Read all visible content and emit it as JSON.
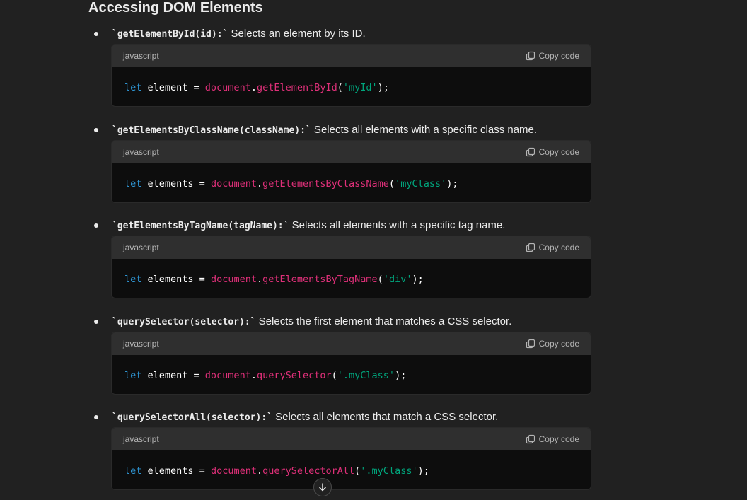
{
  "heading": "Accessing DOM Elements",
  "items": [
    {
      "method": "`getElementById(id):`",
      "description": " Selects an element by its ID.",
      "lang": "javascript",
      "copy_label": "Copy code",
      "code": {
        "kw": "let",
        "var": " element = ",
        "obj": "document",
        "dot": ".",
        "fn": "getElementById",
        "open": "(",
        "str": "'myId'",
        "close": ");"
      }
    },
    {
      "method": "`getElementsByClassName(className):`",
      "description": " Selects all elements with a specific class name.",
      "lang": "javascript",
      "copy_label": "Copy code",
      "code": {
        "kw": "let",
        "var": " elements = ",
        "obj": "document",
        "dot": ".",
        "fn": "getElementsByClassName",
        "open": "(",
        "str": "'myClass'",
        "close": ");"
      }
    },
    {
      "method": "`getElementsByTagName(tagName):`",
      "description": " Selects all elements with a specific tag name.",
      "lang": "javascript",
      "copy_label": "Copy code",
      "code": {
        "kw": "let",
        "var": " elements = ",
        "obj": "document",
        "dot": ".",
        "fn": "getElementsByTagName",
        "open": "(",
        "str": "'div'",
        "close": ");"
      }
    },
    {
      "method": "`querySelector(selector):`",
      "description": " Selects the first element that matches a CSS selector.",
      "lang": "javascript",
      "copy_label": "Copy code",
      "code": {
        "kw": "let",
        "var": " element = ",
        "obj": "document",
        "dot": ".",
        "fn": "querySelector",
        "open": "(",
        "str": "'.myClass'",
        "close": ");"
      }
    },
    {
      "method": "`querySelectorAll(selector):`",
      "description": " Selects all elements that match a CSS selector.",
      "lang": "javascript",
      "copy_label": "Copy code",
      "code": {
        "kw": "let",
        "var": " elements = ",
        "obj": "document",
        "dot": ".",
        "fn": "querySelectorAll",
        "open": "(",
        "str": "'.myClass'",
        "close": ");"
      }
    }
  ],
  "icons": {
    "copy": "copy-icon",
    "scroll_down": "arrow-down-icon"
  },
  "colors": {
    "background": "#212121",
    "code_bg": "#0d0d0d",
    "code_header_bg": "#2f2f2f",
    "keyword": "#2e95d3",
    "function": "#df3079",
    "string": "#00a67d"
  }
}
